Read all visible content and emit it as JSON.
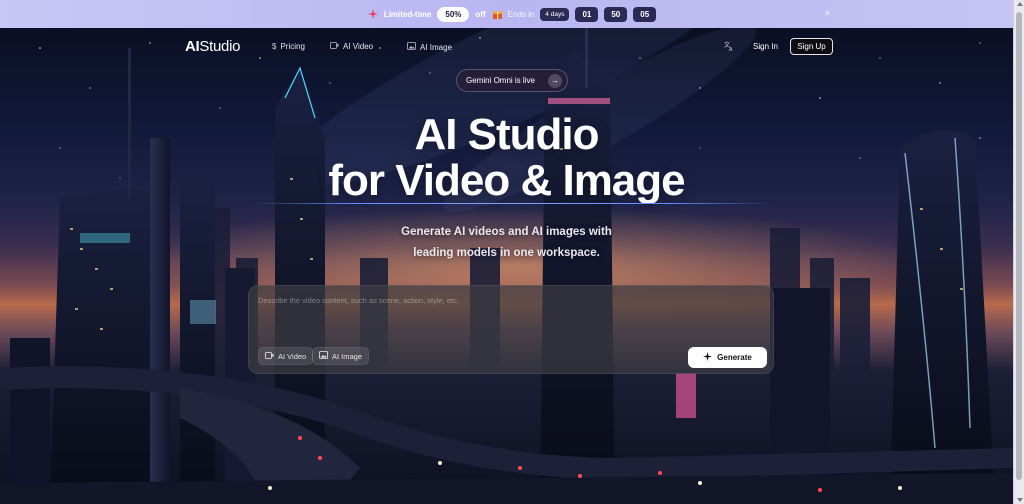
{
  "promo": {
    "limited_time": "Limited-time",
    "discount": "50%",
    "off": "off",
    "ends_in": "Ends in",
    "days": "4 days",
    "hours": "01",
    "minutes": "50",
    "seconds": "05",
    "close_symbol": "×"
  },
  "nav": {
    "logo_ai": "AI",
    "logo_studio": "Studio",
    "links": [
      {
        "label": "Pricing",
        "icon": "dollar-icon"
      },
      {
        "label": "AI Video",
        "icon": "video-icon"
      },
      {
        "label": "AI Image",
        "icon": "image-icon"
      }
    ],
    "sign_in": "Sign In",
    "sign_up": "Sign Up"
  },
  "hero": {
    "live_pill": "Gemini Omni is live",
    "title_line1": "AI Studio",
    "title_line2": "for Video & Image",
    "subtitle_line1": "Generate AI videos and AI images with",
    "subtitle_line2": "leading models in one workspace."
  },
  "prompt": {
    "placeholder": "Describe the video content, such as scene, action, style, etc.",
    "chip_video": "AI Video",
    "chip_image": "AI Image",
    "generate": "Generate"
  },
  "colors": {
    "banner": "#bdb9f3",
    "accent_line": "#6b96ff",
    "button_bg": "#ffffff"
  }
}
